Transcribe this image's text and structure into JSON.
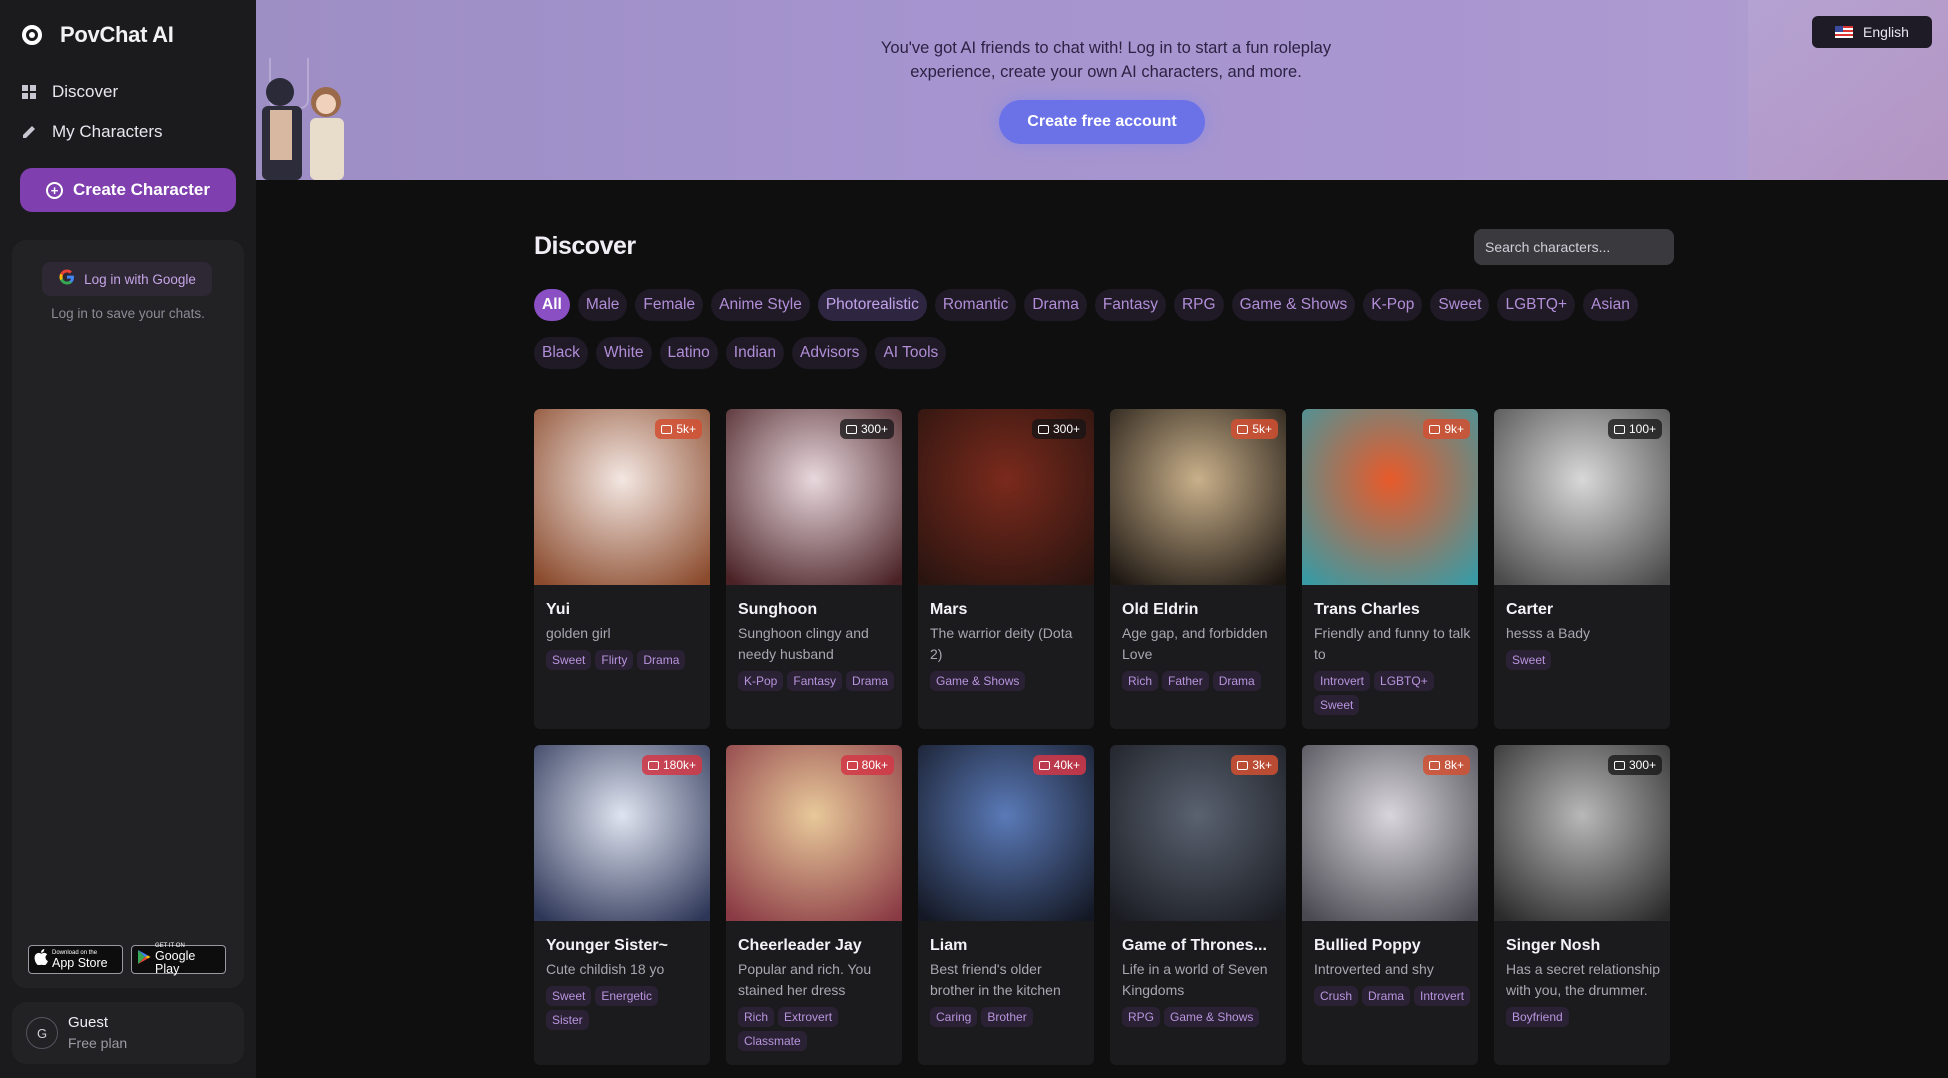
{
  "sidebar": {
    "brand": "PovChat AI",
    "nav": [
      {
        "label": "Discover",
        "icon": "grid-icon"
      },
      {
        "label": "My Characters",
        "icon": "pencil-icon"
      }
    ],
    "create_label": "Create Character",
    "google_label": "Log in with Google",
    "login_note": "Log in to save your chats.",
    "app_store": {
      "small": "Download on the",
      "big": "App Store"
    },
    "google_play": {
      "small": "GET IT ON",
      "big": "Google Play"
    },
    "user": {
      "initial": "G",
      "name": "Guest",
      "plan": "Free plan"
    }
  },
  "banner": {
    "text": "You've got AI friends to chat with! Log in to start a fun roleplay experience, create your own AI characters, and more.",
    "cta": "Create free account",
    "language": "English"
  },
  "main": {
    "title": "Discover",
    "search_placeholder": "Search characters...",
    "filters": [
      "All",
      "Male",
      "Female",
      "Anime Style",
      "Photorealistic",
      "Romantic",
      "Drama",
      "Fantasy",
      "RPG",
      "Game & Shows",
      "K-Pop",
      "Sweet",
      "LGBTQ+",
      "Asian",
      "Black",
      "White",
      "Latino",
      "Indian",
      "Advisors",
      "AI Tools"
    ],
    "active_filter": "All",
    "cards": [
      {
        "name": "Yui",
        "desc": "golden girl",
        "count": "5k+",
        "badge": "hot",
        "tags": [
          "Sweet",
          "Flirty",
          "Drama"
        ],
        "colors": [
          "#f3e7e2",
          "#8a4a2c"
        ]
      },
      {
        "name": "Sunghoon",
        "desc": "Sunghoon clingy and needy husband",
        "count": "300+",
        "badge": "dark",
        "tags": [
          "K-Pop",
          "Fantasy",
          "Drama"
        ],
        "colors": [
          "#e8d8dd",
          "#4a2226"
        ]
      },
      {
        "name": "Mars",
        "desc": "The warrior deity (Dota 2)",
        "count": "300+",
        "badge": "dark",
        "tags": [
          "Game & Shows"
        ],
        "colors": [
          "#7a2a1c",
          "#2a1410"
        ]
      },
      {
        "name": "Old Eldrin",
        "desc": "Age gap, and forbidden Love",
        "count": "5k+",
        "badge": "hot",
        "tags": [
          "Rich",
          "Father",
          "Drama"
        ],
        "colors": [
          "#c9b08a",
          "#1d1712"
        ]
      },
      {
        "name": "Trans Charles",
        "desc": "Friendly and funny to talk to",
        "count": "9k+",
        "badge": "hot",
        "tags": [
          "Introvert",
          "LGBTQ+",
          "Sweet"
        ],
        "colors": [
          "#e85a2a",
          "#3a9aa4"
        ]
      },
      {
        "name": "Carter",
        "desc": "hesss a Bady",
        "count": "100+",
        "badge": "dark",
        "tags": [
          "Sweet"
        ],
        "colors": [
          "#d8d8d8",
          "#4a4a4a"
        ]
      },
      {
        "name": "Younger Sister~",
        "desc": "Cute childish 18 yo",
        "count": "180k+",
        "badge": "red",
        "tags": [
          "Sweet",
          "Energetic",
          "Sister"
        ],
        "colors": [
          "#dfe4f0",
          "#2e3658"
        ]
      },
      {
        "name": "Cheerleader Jay",
        "desc": "Popular and rich. You stained her dress",
        "count": "80k+",
        "badge": "red",
        "tags": [
          "Rich",
          "Extrovert",
          "Classmate"
        ],
        "colors": [
          "#e8c99a",
          "#8a3a44"
        ]
      },
      {
        "name": "Liam",
        "desc": "Best friend's older brother in the kitchen",
        "count": "40k+",
        "badge": "red",
        "tags": [
          "Caring",
          "Brother"
        ],
        "colors": [
          "#5a7ab8",
          "#141824"
        ]
      },
      {
        "name": "Game of Thrones...",
        "desc": "Life in a world of Seven Kingdoms",
        "count": "3k+",
        "badge": "hot",
        "tags": [
          "RPG",
          "Game & Shows"
        ],
        "colors": [
          "#5a6270",
          "#1a1c22"
        ]
      },
      {
        "name": "Bullied Poppy",
        "desc": "Introverted and shy",
        "count": "8k+",
        "badge": "hot",
        "tags": [
          "Crush",
          "Drama",
          "Introvert"
        ],
        "colors": [
          "#d8d6dc",
          "#4a4850"
        ]
      },
      {
        "name": "Singer Nosh",
        "desc": "Has a secret relationship with you, the drummer.",
        "count": "300+",
        "badge": "dark",
        "tags": [
          "Boyfriend"
        ],
        "colors": [
          "#b8b8b8",
          "#2a2a2a"
        ]
      }
    ]
  },
  "colors": {
    "accent": "#7f3fae",
    "banner": "#a594cf",
    "cta": "#6b72e8"
  }
}
